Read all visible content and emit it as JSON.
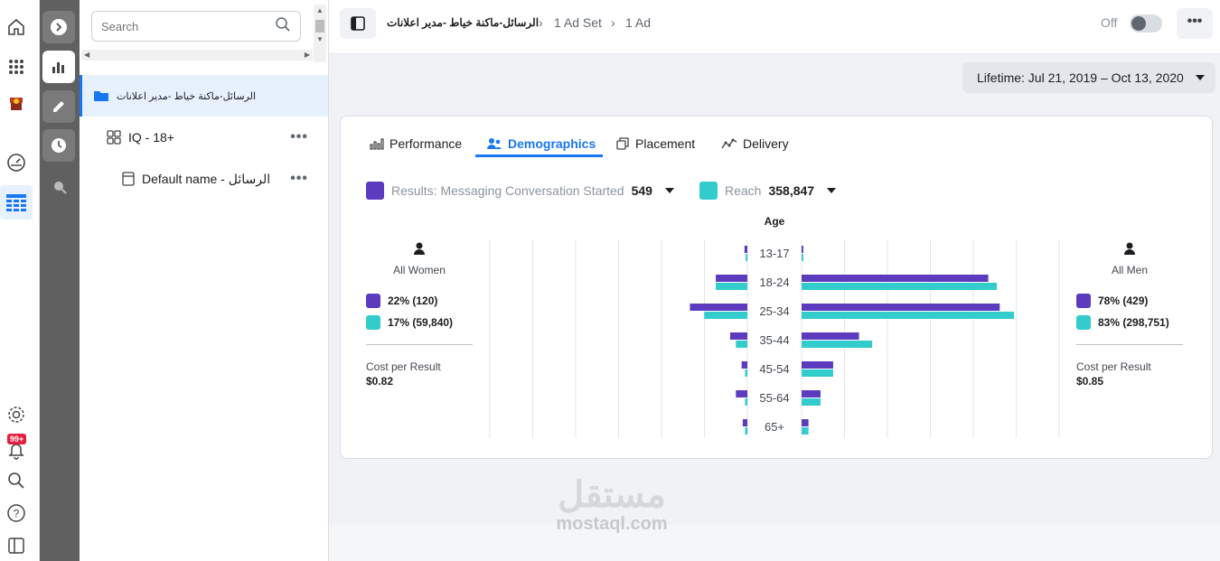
{
  "rail": {
    "icons": [
      "home-icon",
      "apps-grid-icon",
      "store-icon",
      "dashboard-icon",
      "table-view-icon",
      "settings-icon",
      "notifications-icon",
      "search-icon",
      "help-icon",
      "panel-icon"
    ],
    "notification_badge": "99+"
  },
  "tools": {
    "icons": [
      "expand-icon",
      "bar-chart-icon",
      "edit-icon",
      "history-icon",
      "inspect-icon"
    ]
  },
  "tree": {
    "search_placeholder": "Search",
    "campaign_name": "الرسائل-ماكنة خياط -مدير اعلانات",
    "adset_name": "IQ - 18+",
    "ad_name": "Default name - الرسائل",
    "more_label": "•••"
  },
  "topbar": {
    "campaign": "الرسائل-ماكنة خياط -مدير اعلانات",
    "adset": "1 Ad Set",
    "ad": "1 Ad",
    "separator": "›",
    "status_label": "Off",
    "more_label": "•••"
  },
  "date_range": "Lifetime: Jul 21, 2019 – Oct 13, 2020",
  "tabs": [
    "Performance",
    "Demographics",
    "Placement",
    "Delivery"
  ],
  "active_tab": "Demographics",
  "metrics": {
    "results_label": "Results: Messaging Conversation Started",
    "results_value": "549",
    "reach_label": "Reach",
    "reach_value": "358,847"
  },
  "colors": {
    "results": "#5c3bbf",
    "reach": "#33cccc",
    "accent": "#1877f2"
  },
  "women": {
    "label": "All Women",
    "results": "22% (120)",
    "reach": "17% (59,840)",
    "cpr_label": "Cost per Result",
    "cpr_value": "$0.82"
  },
  "men": {
    "label": "All Men",
    "results": "78% (429)",
    "reach": "83% (298,751)",
    "cpr_label": "Cost per Result",
    "cpr_value": "$0.85"
  },
  "chart_data": {
    "type": "bar",
    "title": "Age",
    "categories": [
      "13-17",
      "18-24",
      "25-34",
      "35-44",
      "45-54",
      "55-64",
      "65+"
    ],
    "series": [
      {
        "name": "Results: Messaging Conversation Started",
        "group": "women",
        "values": [
          0.5,
          5.5,
          10,
          3,
          1,
          2,
          0.8
        ]
      },
      {
        "name": "Reach",
        "group": "women",
        "values": [
          0.3,
          5.5,
          7.5,
          2,
          0.4,
          0.4,
          0.4
        ]
      },
      {
        "name": "Results: Messaging Conversation Started",
        "group": "men",
        "values": [
          0.3,
          32.5,
          34.5,
          10,
          5.5,
          3.3,
          1.2
        ]
      },
      {
        "name": "Reach",
        "group": "men",
        "values": [
          0.3,
          34,
          37,
          12.3,
          5.5,
          3.3,
          1.2
        ]
      }
    ],
    "xlim": [
      0,
      45
    ],
    "grid": true
  },
  "watermark": {
    "arabic": "مستقل",
    "latin": "mostaql.com"
  }
}
